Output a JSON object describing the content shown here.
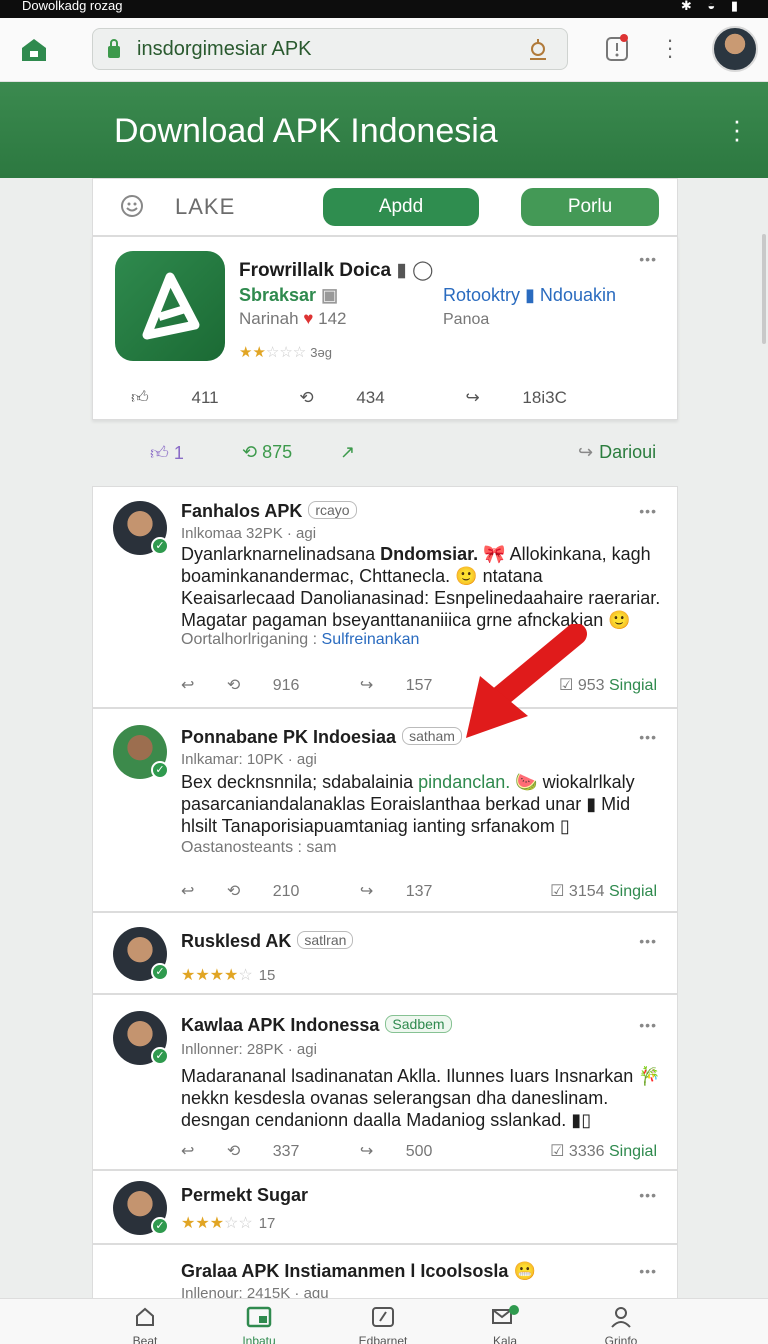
{
  "status_bar": {
    "title": "Dowolkadg rozag"
  },
  "browser": {
    "url": "insdorgimesiar APK"
  },
  "header": {
    "title": "Download APK Indonesia"
  },
  "filter": {
    "label": "LAKE",
    "button_1": "Apdd",
    "button_2": "Porlu"
  },
  "featured": {
    "name": "Frowrillalk Doica",
    "subtitle": "Sbraksar",
    "narinah": "Narinah",
    "likes": "142",
    "rating": 2.5,
    "rating_label": "3əg",
    "link": "Rotooktry ▮ Ndouakin",
    "panoa": "Panoa",
    "actions": {
      "like": "411",
      "repost": "434",
      "share": "18i3C"
    }
  },
  "engagement": {
    "likes": "1",
    "reposts": "875",
    "download": "Darioui"
  },
  "posts": [
    {
      "name": "Fanhalos APK",
      "tag": "rcayo",
      "meta": "Inlkomaa 32PK · agi",
      "body_pre": "Dyanlarknarnelinadsana ",
      "body_bold": "Dndomsiar.",
      "body_rest": " 🎀 Allokinkana, kagh boaminkanandermac, Chttanecla. 🙂 ntatana Keaisarlecaad Danolianasinad: Esnpelinedaahaire raerariar. Magatar pagaman bseyanttananiiica grne afnckakian 🙂",
      "footer_label": "Oortalhorlriganing :",
      "footer_link": "Sulfreinankan",
      "reply": "",
      "reposts": "916",
      "shares": "157",
      "signals": "953",
      "signal_label": "Singial"
    },
    {
      "name": "Ponnabane PK Indoesiaa",
      "tag": "satham",
      "meta": "Inlkamar: 10PK · agi",
      "body_pre": "Bex decknsnnila; sdabalainia ",
      "body_green": "pindanclan.",
      "body_rest": " 🍉 wiokalrlkaly pasarcaniandalanaklas Eoraislanthaa berkad unar ▮ Mid hlsilt Tanaporisiapuamtaniag ianting srfanakom ▯",
      "footer": "Oastanosteants  :  sam",
      "reposts": "210",
      "shares": "137",
      "signals": "3154",
      "signal_label": "Singial"
    },
    {
      "name": "Rusklesd AK",
      "tag": "satlran",
      "rating": 3.5,
      "count": "15"
    },
    {
      "name": "Kawlaa APK Indonessa",
      "tag": "Sadbem",
      "meta": "Inllonner: 28PK · agi",
      "body": "Madarananal lsadinanatan Aklla. Ilunnes Iuars Insnarkan 🎋 nekkn kesdesla ovanas selerangsan dha daneslinam. desngan cendanionn daalla Madaniog sslankad. ▮▯",
      "reposts": "337",
      "shares": "500",
      "signals": "3336",
      "signal_label": "Singial"
    },
    {
      "name": "Permekt Sugar",
      "rating": 2.5,
      "count": "17"
    },
    {
      "name": "Gralaa APK Instiamanmen l Icoolsosla 😬",
      "meta": "Inllenour: 2415K · agu"
    }
  ],
  "nav": [
    {
      "label": "Beat",
      "icon": "home-icon"
    },
    {
      "label": "Inbatu",
      "icon": "inbox-icon"
    },
    {
      "label": "Edbarnet",
      "icon": "edit-icon"
    },
    {
      "label": "Kala",
      "icon": "messages-icon"
    },
    {
      "label": "Grinfo",
      "icon": "profile-icon"
    }
  ],
  "colors": {
    "brand_green": "#2f8a4e",
    "header_green": "#3b8a4f",
    "link_blue": "#2a6bbf",
    "arrow_red": "#e01b1b"
  }
}
